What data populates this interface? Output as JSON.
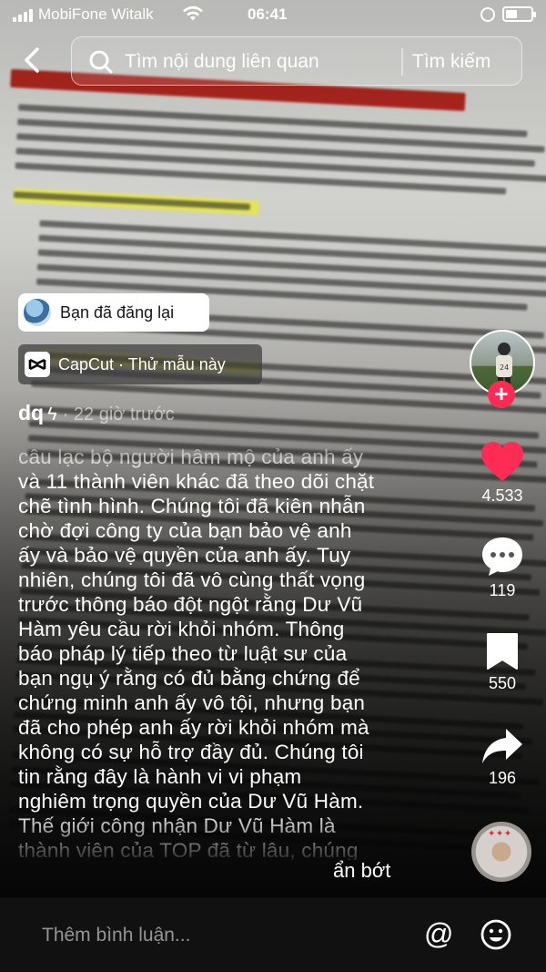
{
  "status_bar": {
    "carrier": "MobiFone Witalk",
    "time": "06:41"
  },
  "search": {
    "placeholder": "Tìm nội dung liên quan",
    "button_label": "Tìm kiếm"
  },
  "repost_label": "Bạn đã đăng lại",
  "capcut_label": "CapCut · Thử mẫu này",
  "author": {
    "name": "dq",
    "time_ago": "· 22 giờ trước"
  },
  "caption": {
    "lines": [
      "câu lạc bộ người hâm mộ của anh ấy",
      "và 11 thành viên khác đã theo dõi chặt",
      "chẽ tình hình. Chúng tôi đã kiên nhẫn",
      "chờ đợi công ty của bạn bảo vệ anh",
      "ấy và bảo vệ quyền của anh ấy. Tuy",
      "nhiên, chúng tôi đã vô cùng thất vọng",
      "trước thông báo đột ngột rằng Dư Vũ",
      "Hàm yêu cầu rời khỏi nhóm. Thông",
      "báo pháp lý tiếp theo từ luật sư của",
      "bạn ngụ ý rằng có đủ bằng chứng để",
      "chứng minh anh ấy vô tội, nhưng bạn",
      "đã cho phép anh ấy rời khỏi nhóm mà",
      "không có sự hỗ trợ đầy đủ. Chúng tôi",
      "tin rằng đây là hành vi vi phạm",
      "nghiêm trọng quyền của Dư Vũ Hàm.",
      "Thế giới công nhận Dư Vũ Hàm là",
      "thành viên của TOP đã từ lâu, chúng"
    ],
    "collapse_label": "ẩn bớt"
  },
  "actions": {
    "likes": "4.533",
    "comments": "119",
    "saves": "550",
    "shares": "196"
  },
  "comment_bar": {
    "placeholder": "Thêm bình luận...",
    "mention_symbol": "@"
  },
  "colors": {
    "like_red": "#fe2c55",
    "follow_red": "#fe2c55"
  }
}
